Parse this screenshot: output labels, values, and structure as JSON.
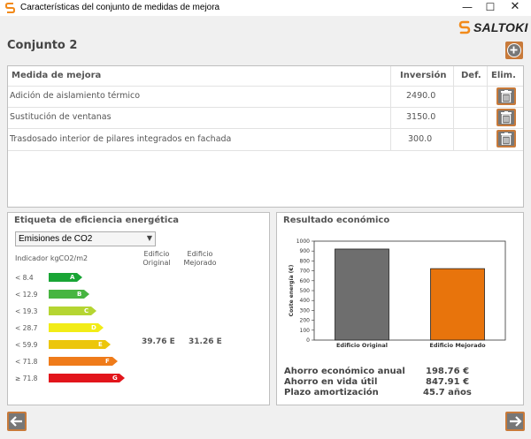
{
  "window": {
    "title": "Características del conjunto de medidas de mejora",
    "minimize_glyph": "—",
    "maximize_glyph": "☐",
    "close_glyph": "✕"
  },
  "brand": {
    "name": "SALTOKI",
    "icon": "saltoki-s-logo",
    "accent": "#c87a3a"
  },
  "set": {
    "title": "Conjunto 2",
    "add_icon": "plus-circle-icon"
  },
  "measures": {
    "headers": {
      "measure": "Medida de mejora",
      "investment": "Inversión",
      "default": "Def.",
      "delete": "Elim."
    },
    "rows": [
      {
        "name": "Adición de aislamiento térmico",
        "investment": "2490.0"
      },
      {
        "name": "Sustitución de ventanas",
        "investment": "3150.0"
      },
      {
        "name": "Trasdosado interior de pilares integrados en fachada",
        "investment": "300.0"
      }
    ]
  },
  "energy": {
    "title": "Etiqueta de eficiencia energética",
    "selector_value": "Emisiones de CO2",
    "indicator_label": "Indicador kgCO2/m2",
    "col_original": [
      "Edificio",
      "Original"
    ],
    "col_improved": [
      "Edificio",
      "Mejorado"
    ],
    "ratings": [
      {
        "limit": "< 8.4",
        "letter": "A",
        "color": "#19a535"
      },
      {
        "limit": "< 12.9",
        "letter": "B",
        "color": "#47b541"
      },
      {
        "limit": "< 19.3",
        "letter": "C",
        "color": "#b5d532"
      },
      {
        "limit": "< 28.7",
        "letter": "D",
        "color": "#f2ec17"
      },
      {
        "limit": "< 59.9",
        "letter": "E",
        "color": "#ecc60b"
      },
      {
        "limit": "< 71.8",
        "letter": "F",
        "color": "#ef7b1a"
      },
      {
        "limit": "≥ 71.8",
        "letter": "G",
        "color": "#e2151b"
      }
    ],
    "original_value": "39.76 E",
    "improved_value": "31.26 E",
    "active_rating": "E"
  },
  "economic": {
    "title": "Resultado económico",
    "savings_annual_label": "Ahorro económico anual",
    "savings_annual_value": "198.76 €",
    "savings_life_label": "Ahorro en vida útil",
    "savings_life_value": "847.91 €",
    "payback_label": "Plazo amortización",
    "payback_value": "45.7 años"
  },
  "chart_data": {
    "type": "bar",
    "ylabel": "Coste energía (€)",
    "ylim": [
      0,
      1000
    ],
    "yticks": [
      0,
      100,
      200,
      300,
      400,
      500,
      600,
      700,
      800,
      900,
      1000
    ],
    "categories": [
      "Edificio Original",
      "Edificio Mejorado"
    ],
    "values": [
      920,
      722
    ],
    "colors": [
      "#6e6e6e",
      "#e8740c"
    ],
    "grid": false
  },
  "navigation": {
    "prev_icon": "arrow-left-icon",
    "next_icon": "arrow-right-icon"
  }
}
